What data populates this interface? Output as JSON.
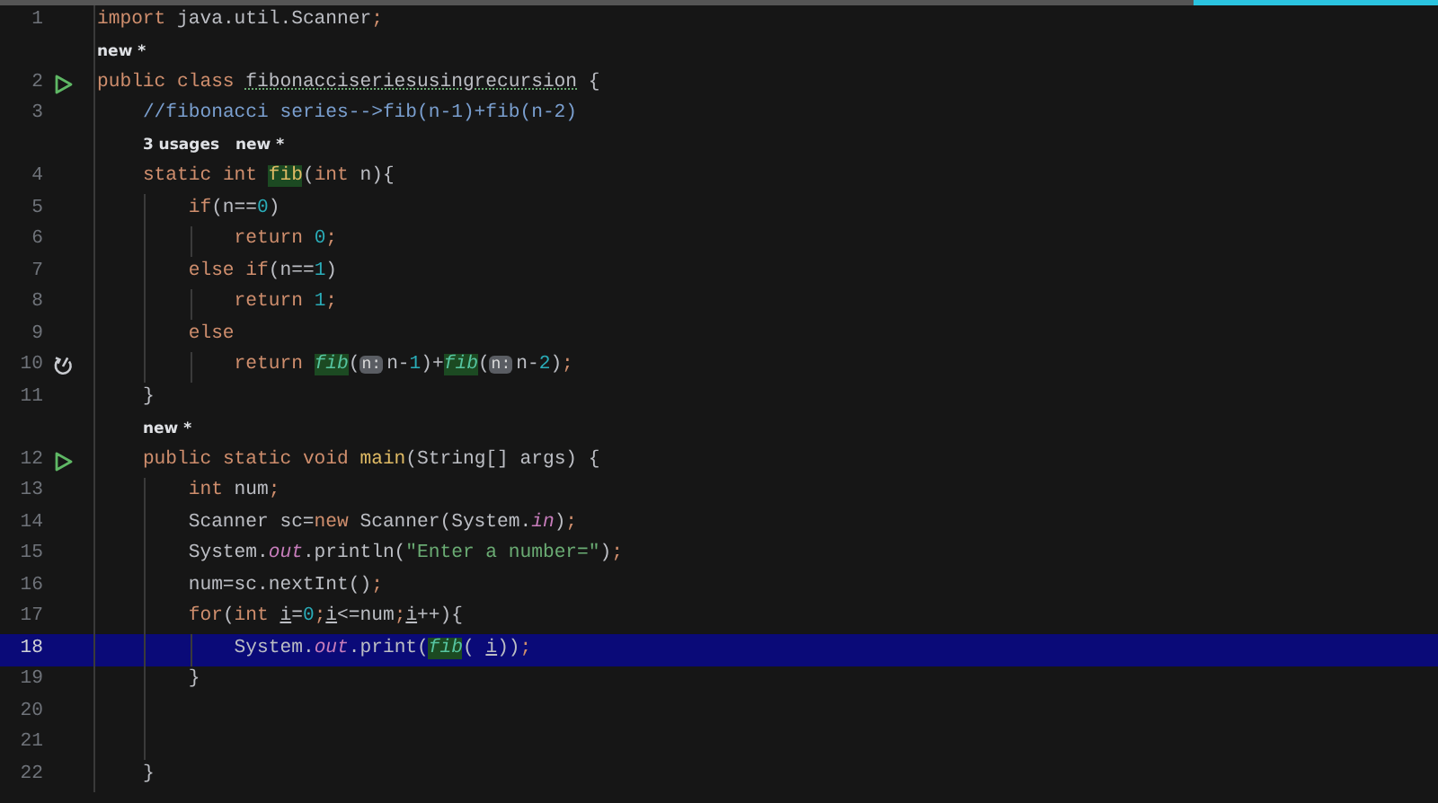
{
  "editor": {
    "lines": [
      {
        "kind": "code",
        "number": "1",
        "selected": false,
        "tokens": [
          {
            "kind": "keyword",
            "text": "import"
          },
          {
            "kind": "plain",
            "text": " java.util.Scanner"
          },
          {
            "kind": "keyword",
            "text": ";"
          }
        ]
      },
      {
        "kind": "hint",
        "hints": [
          "new *"
        ]
      },
      {
        "kind": "code",
        "number": "2",
        "gutter": {
          "kind": "run"
        },
        "selected": false,
        "tokens": [
          {
            "kind": "keyword",
            "text": "public class "
          },
          {
            "kind": "plain",
            "text": "fibonacciseriesusingrecursion",
            "warning": true
          },
          {
            "kind": "plain",
            "text": " {"
          }
        ]
      },
      {
        "kind": "code",
        "number": "3",
        "selected": false,
        "tokens": [
          {
            "kind": "comment",
            "text": "    //fibonacci series-->fib(n-1)+fib(n-2)"
          }
        ]
      },
      {
        "kind": "hint",
        "hints": [
          "3 usages",
          "new *"
        ]
      },
      {
        "kind": "code",
        "number": "4",
        "selected": false,
        "tokens": [
          {
            "kind": "keyword",
            "text": "    static int "
          },
          {
            "kind": "method",
            "text": "fib",
            "highlighted": true
          },
          {
            "kind": "plain",
            "text": "("
          },
          {
            "kind": "keyword",
            "text": "int "
          },
          {
            "kind": "plain",
            "text": "n){"
          }
        ]
      },
      {
        "kind": "code",
        "number": "5",
        "selected": false,
        "tokens": [
          {
            "kind": "keyword",
            "text": "        if"
          },
          {
            "kind": "plain",
            "text": "(n=="
          },
          {
            "kind": "number",
            "text": "0"
          },
          {
            "kind": "plain",
            "text": ")"
          }
        ]
      },
      {
        "kind": "code",
        "number": "6",
        "selected": false,
        "tokens": [
          {
            "kind": "keyword",
            "text": "            return "
          },
          {
            "kind": "number",
            "text": "0"
          },
          {
            "kind": "keyword",
            "text": ";"
          }
        ]
      },
      {
        "kind": "code",
        "number": "7",
        "selected": false,
        "tokens": [
          {
            "kind": "keyword",
            "text": "        else if"
          },
          {
            "kind": "plain",
            "text": "(n=="
          },
          {
            "kind": "number",
            "text": "1"
          },
          {
            "kind": "plain",
            "text": ")"
          }
        ]
      },
      {
        "kind": "code",
        "number": "8",
        "selected": false,
        "tokens": [
          {
            "kind": "keyword",
            "text": "            return "
          },
          {
            "kind": "number",
            "text": "1"
          },
          {
            "kind": "keyword",
            "text": ";"
          }
        ]
      },
      {
        "kind": "code",
        "number": "9",
        "selected": false,
        "tokens": [
          {
            "kind": "keyword",
            "text": "        else"
          }
        ]
      },
      {
        "kind": "code",
        "number": "10",
        "gutter": {
          "kind": "recursion"
        },
        "selected": false,
        "tokens": [
          {
            "kind": "keyword",
            "text": "            return "
          },
          {
            "kind": "call",
            "text": "fib",
            "highlighted": true
          },
          {
            "kind": "plain",
            "text": "("
          },
          {
            "kind": "param-hint",
            "text": "n:"
          },
          {
            "kind": "plain",
            "text": "n-"
          },
          {
            "kind": "number",
            "text": "1"
          },
          {
            "kind": "plain",
            "text": ")+"
          },
          {
            "kind": "call",
            "text": "fib",
            "highlighted": true
          },
          {
            "kind": "plain",
            "text": "("
          },
          {
            "kind": "param-hint",
            "text": "n:"
          },
          {
            "kind": "plain",
            "text": "n-"
          },
          {
            "kind": "number",
            "text": "2"
          },
          {
            "kind": "plain",
            "text": ")"
          },
          {
            "kind": "keyword",
            "text": ";"
          }
        ]
      },
      {
        "kind": "code",
        "number": "11",
        "selected": false,
        "tokens": [
          {
            "kind": "plain",
            "text": "    }"
          }
        ]
      },
      {
        "kind": "hint",
        "hints": [
          "new *"
        ]
      },
      {
        "kind": "code",
        "number": "12",
        "gutter": {
          "kind": "run"
        },
        "selected": false,
        "tokens": [
          {
            "kind": "keyword",
            "text": "    public static void "
          },
          {
            "kind": "method",
            "text": "main"
          },
          {
            "kind": "plain",
            "text": "(String[] args) {"
          }
        ]
      },
      {
        "kind": "code",
        "number": "13",
        "selected": false,
        "tokens": [
          {
            "kind": "keyword",
            "text": "        int "
          },
          {
            "kind": "plain",
            "text": "num"
          },
          {
            "kind": "keyword",
            "text": ";"
          }
        ]
      },
      {
        "kind": "code",
        "number": "14",
        "selected": false,
        "tokens": [
          {
            "kind": "plain",
            "text": "        Scanner sc="
          },
          {
            "kind": "keyword",
            "text": "new "
          },
          {
            "kind": "plain",
            "text": "Scanner(System."
          },
          {
            "kind": "field",
            "text": "in"
          },
          {
            "kind": "plain",
            "text": ")"
          },
          {
            "kind": "keyword",
            "text": ";"
          }
        ]
      },
      {
        "kind": "code",
        "number": "15",
        "selected": false,
        "tokens": [
          {
            "kind": "plain",
            "text": "        System."
          },
          {
            "kind": "field",
            "text": "out"
          },
          {
            "kind": "plain",
            "text": ".println("
          },
          {
            "kind": "string",
            "text": "\"Enter a number=\""
          },
          {
            "kind": "plain",
            "text": ")"
          },
          {
            "kind": "keyword",
            "text": ";"
          }
        ]
      },
      {
        "kind": "code",
        "number": "16",
        "selected": false,
        "tokens": [
          {
            "kind": "plain",
            "text": "        num=sc.nextInt()"
          },
          {
            "kind": "keyword",
            "text": ";"
          }
        ]
      },
      {
        "kind": "code",
        "number": "17",
        "selected": false,
        "tokens": [
          {
            "kind": "keyword",
            "text": "        for"
          },
          {
            "kind": "plain",
            "text": "("
          },
          {
            "kind": "keyword",
            "text": "int "
          },
          {
            "kind": "var",
            "text": "i"
          },
          {
            "kind": "plain",
            "text": "="
          },
          {
            "kind": "number",
            "text": "0"
          },
          {
            "kind": "keyword",
            "text": ";"
          },
          {
            "kind": "var",
            "text": "i"
          },
          {
            "kind": "plain",
            "text": "<=num"
          },
          {
            "kind": "keyword",
            "text": ";"
          },
          {
            "kind": "var",
            "text": "i"
          },
          {
            "kind": "plain",
            "text": "++){"
          }
        ]
      },
      {
        "kind": "code",
        "number": "18",
        "selected": true,
        "tokens": [
          {
            "kind": "plain",
            "text": "            System."
          },
          {
            "kind": "field",
            "text": "out"
          },
          {
            "kind": "plain",
            "text": ".print("
          },
          {
            "kind": "call",
            "text": "fib",
            "highlighted": true
          },
          {
            "kind": "plain",
            "text": "( "
          },
          {
            "kind": "var",
            "text": "i"
          },
          {
            "kind": "plain",
            "text": "))"
          },
          {
            "kind": "keyword",
            "text": ";"
          }
        ]
      },
      {
        "kind": "code",
        "number": "19",
        "selected": false,
        "tokens": [
          {
            "kind": "plain",
            "text": "        }"
          }
        ]
      },
      {
        "kind": "code",
        "number": "20",
        "selected": false
      },
      {
        "kind": "code",
        "number": "21",
        "selected": false
      },
      {
        "kind": "code",
        "number": "22",
        "selected": false,
        "tokens": [
          {
            "kind": "plain",
            "text": "    }"
          }
        ]
      }
    ]
  }
}
